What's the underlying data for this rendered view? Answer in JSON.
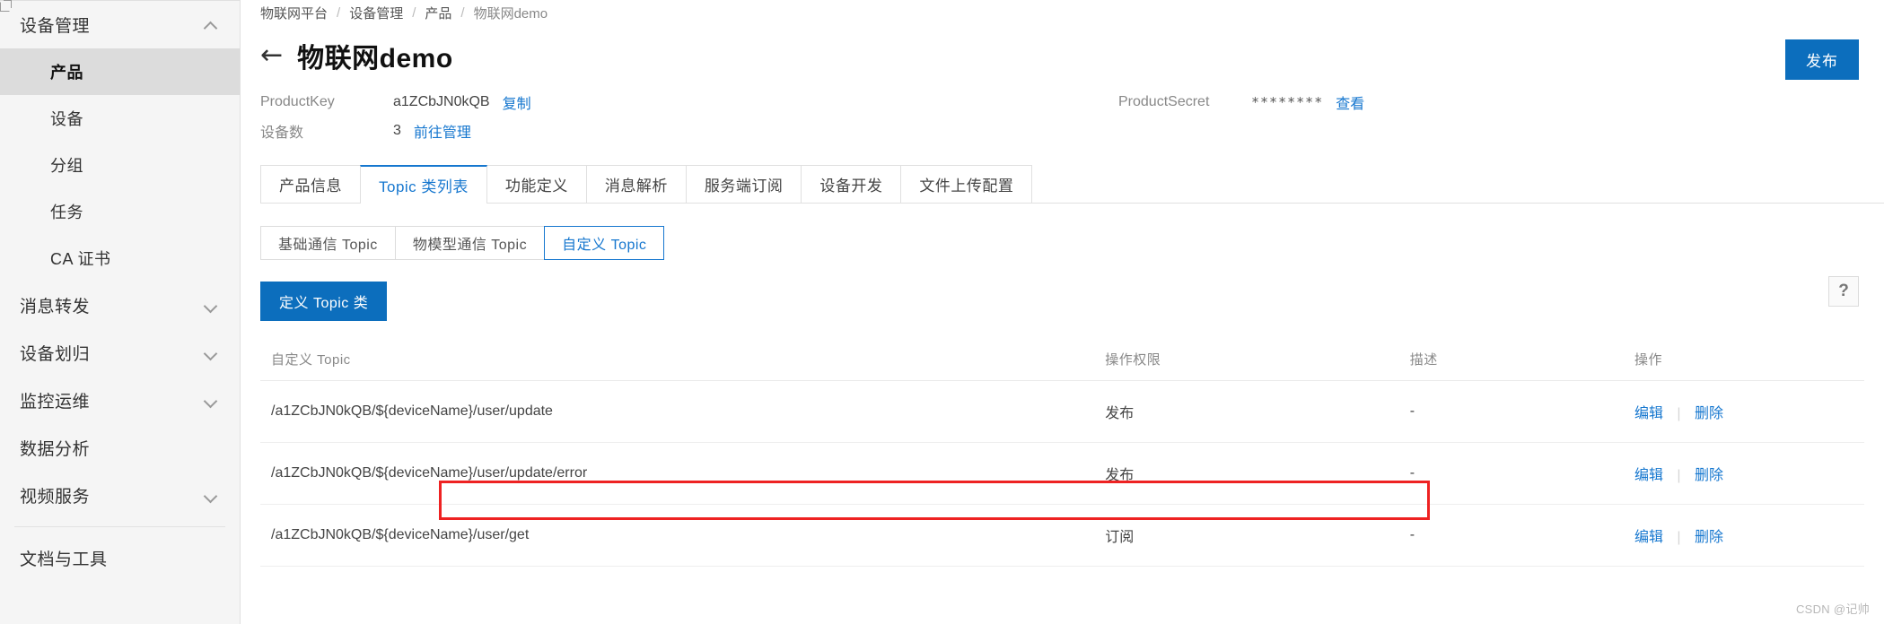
{
  "sidebar": {
    "group": {
      "label": "设备管理",
      "caret": "chevron-up-icon"
    },
    "items": [
      {
        "label": "产品",
        "active": true
      },
      {
        "label": "设备",
        "active": false
      },
      {
        "label": "分组",
        "active": false
      },
      {
        "label": "任务",
        "active": false
      },
      {
        "label": "CA 证书",
        "active": false
      }
    ],
    "groups": [
      {
        "label": "消息转发",
        "caret": "chevron-down-icon",
        "external": false
      },
      {
        "label": "设备划归",
        "caret": "chevron-down-icon",
        "external": false
      },
      {
        "label": "监控运维",
        "caret": "chevron-down-icon",
        "external": false
      },
      {
        "label": "数据分析",
        "caret": "",
        "external": true
      },
      {
        "label": "视频服务",
        "caret": "chevron-down-icon",
        "external": false
      }
    ],
    "bottom": {
      "label": "文档与工具"
    }
  },
  "breadcrumb": {
    "items": [
      "物联网平台",
      "设备管理",
      "产品",
      "物联网demo"
    ],
    "separator": "/"
  },
  "header": {
    "back_icon": "←",
    "title": "物联网demo",
    "publish_label": "发布"
  },
  "meta": {
    "product_key": {
      "label": "ProductKey",
      "value": "a1ZCbJN0kQB",
      "action": "复制"
    },
    "device_count": {
      "label": "设备数",
      "value": "3",
      "action": "前往管理"
    },
    "product_secret": {
      "label": "ProductSecret",
      "value": "********",
      "action": "查看"
    }
  },
  "tabs": [
    {
      "label": "产品信息",
      "active": false
    },
    {
      "label": "Topic 类列表",
      "active": true
    },
    {
      "label": "功能定义",
      "active": false
    },
    {
      "label": "消息解析",
      "active": false
    },
    {
      "label": "服务端订阅",
      "active": false
    },
    {
      "label": "设备开发",
      "active": false
    },
    {
      "label": "文件上传配置",
      "active": false
    }
  ],
  "subtabs": [
    {
      "label": "基础通信 Topic",
      "active": false
    },
    {
      "label": "物模型通信 Topic",
      "active": false
    },
    {
      "label": "自定义 Topic",
      "active": true
    }
  ],
  "toolbar": {
    "define_topic_label": "定义 Topic 类",
    "help_label": "?"
  },
  "table": {
    "columns": [
      "自定义 Topic",
      "操作权限",
      "描述",
      "操作"
    ],
    "rows": [
      {
        "topic": "/a1ZCbJN0kQB/${deviceName}/user/update",
        "permission": "发布",
        "description": "-",
        "edit": "编辑",
        "delete": "删除",
        "highlighted": false
      },
      {
        "topic": "/a1ZCbJN0kQB/${deviceName}/user/update/error",
        "permission": "发布",
        "description": "-",
        "edit": "编辑",
        "delete": "删除",
        "highlighted": false
      },
      {
        "topic": "/a1ZCbJN0kQB/${deviceName}/user/get",
        "permission": "订阅",
        "description": "-",
        "edit": "编辑",
        "delete": "删除",
        "highlighted": true
      }
    ]
  },
  "watermark": {
    "text": "CSDN @记帅"
  },
  "colors": {
    "accent": "#1677cf",
    "primary_button": "#0c6ebd",
    "highlight_box": "#ee2222",
    "sidebar_bg": "#f5f5f5",
    "active_item_bg": "#dcdcdc"
  }
}
